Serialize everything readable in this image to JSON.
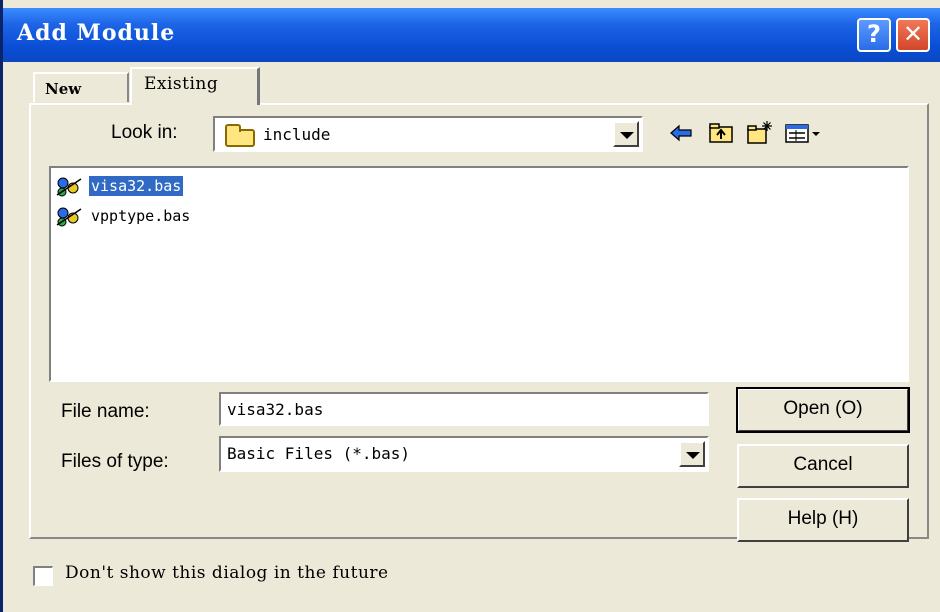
{
  "window": {
    "title": "Add Module",
    "help_label": "?",
    "close_label": "✕"
  },
  "tabs": [
    {
      "label": "New"
    },
    {
      "label": "Existing"
    }
  ],
  "look_in": {
    "label": "Look in:",
    "value": "include"
  },
  "toolbar": {
    "icons": [
      "back-arrow-icon",
      "up-folder-icon",
      "new-folder-icon",
      "view-menu-icon"
    ]
  },
  "files": [
    {
      "name": "visa32.bas",
      "selected": true
    },
    {
      "name": "vpptype.bas",
      "selected": false
    }
  ],
  "file_name": {
    "label": "File name:",
    "value": "visa32.bas"
  },
  "file_type": {
    "label": "Files of type:",
    "value": "Basic Files (*.bas)"
  },
  "buttons": {
    "open": "Open (O)",
    "cancel": "Cancel",
    "help": "Help (H)"
  },
  "checkbox": {
    "label": "Don't show this dialog in the future",
    "checked": false
  },
  "colors": {
    "titlebar": "#0A4FD6",
    "selection": "#316AC5",
    "dialog_bg": "#ECE9D8"
  }
}
